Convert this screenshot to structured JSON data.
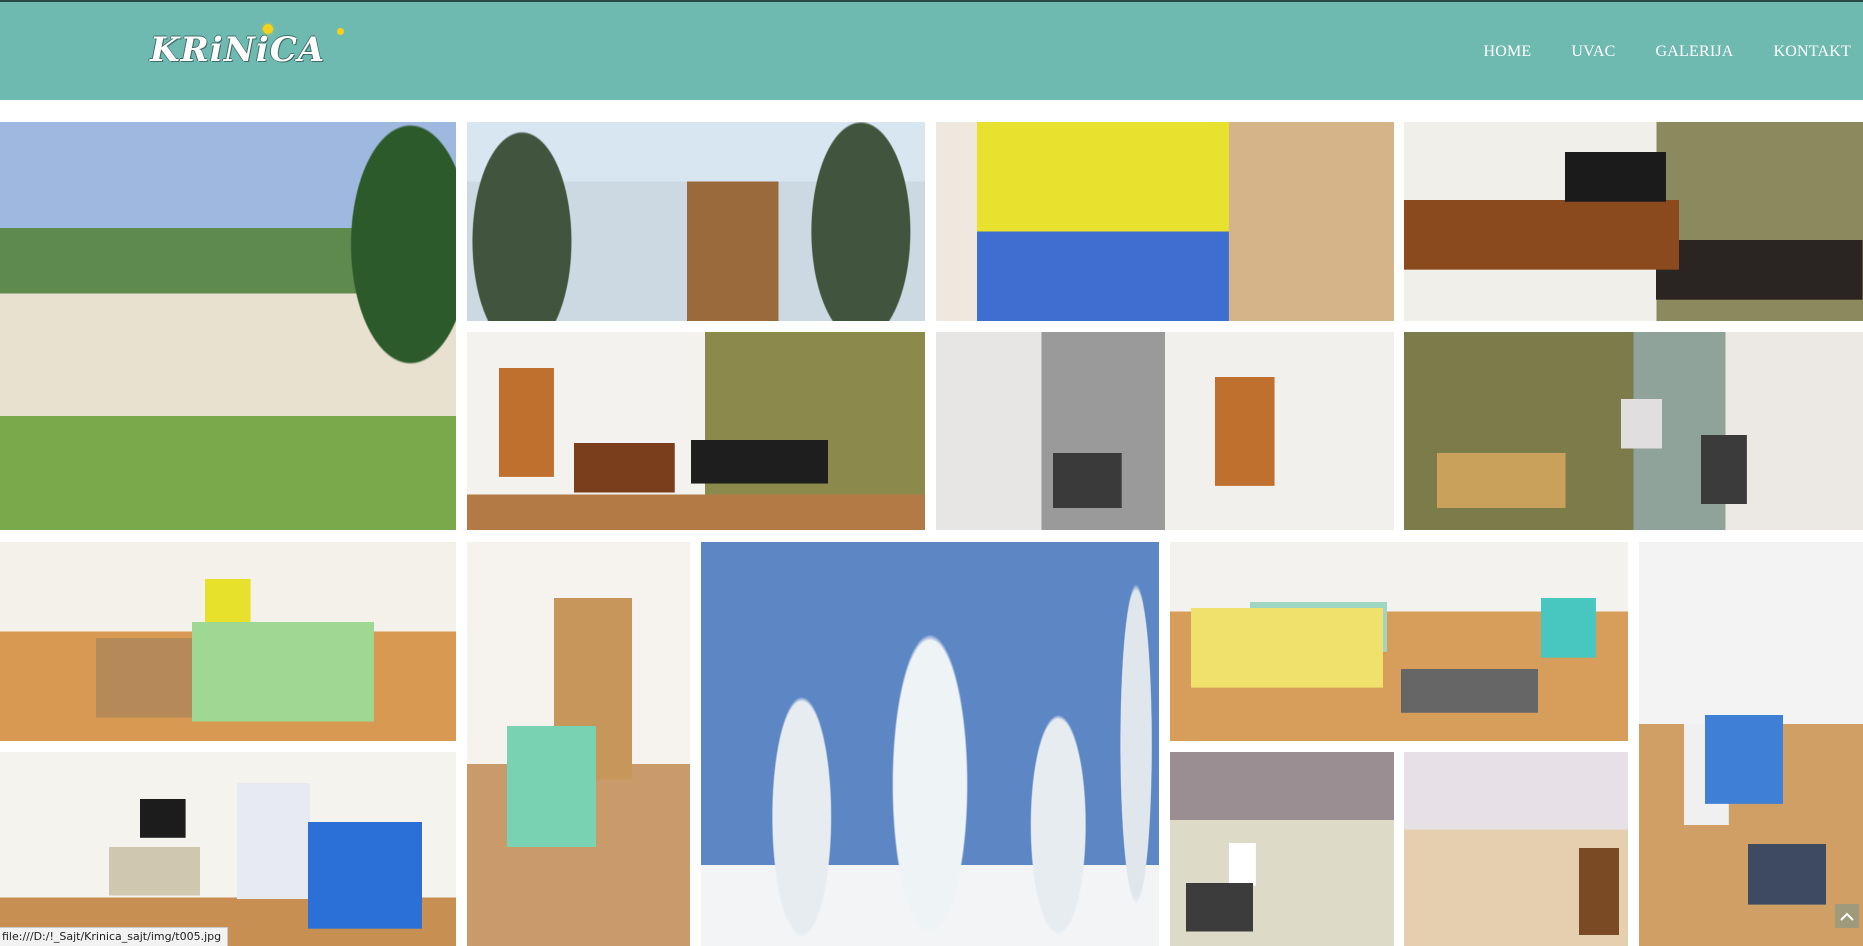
{
  "header": {
    "logo_text": "KRiNiCA",
    "nav": [
      {
        "label": "HOME"
      },
      {
        "label": "UVAC"
      },
      {
        "label": "GALERIJA"
      },
      {
        "label": "KONTAKT"
      }
    ],
    "background_color": "#6fbab0"
  },
  "gallery": {
    "tiles": [
      {
        "name": "house-summer-photo"
      },
      {
        "name": "house-winter-photo"
      },
      {
        "name": "toys-attic-photo"
      },
      {
        "name": "living-room-tv-photo"
      },
      {
        "name": "living-room-wide-photo"
      },
      {
        "name": "kitchen-fireplace-photo"
      },
      {
        "name": "dining-room-photo"
      },
      {
        "name": "bedroom-green-photo"
      },
      {
        "name": "balcony-room-photo"
      },
      {
        "name": "snowy-trees-photo"
      },
      {
        "name": "bedroom-yellow-photo"
      },
      {
        "name": "bedroom-blue-photo"
      },
      {
        "name": "room-tv-wardrobe-photo"
      },
      {
        "name": "kitchen-cabinets-photo"
      },
      {
        "name": "kitchen-corner-photo"
      }
    ]
  },
  "status_bar": {
    "url": "file:///D:/!_Sajt/Krinica_sajt/img/t005.jpg"
  },
  "scroll_top": {
    "icon": "chevron-up-icon"
  }
}
